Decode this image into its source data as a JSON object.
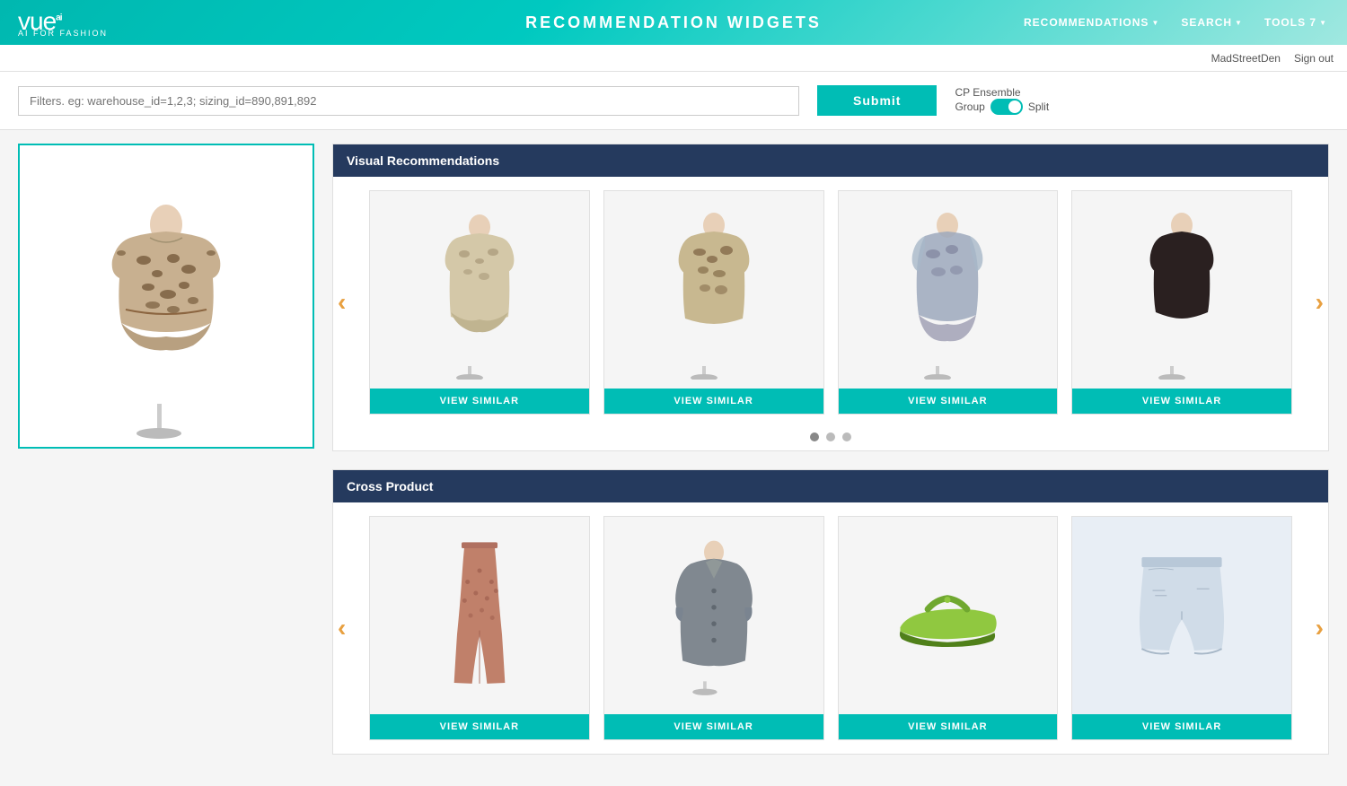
{
  "header": {
    "logo": "vue",
    "logo_sup": "ai",
    "logo_sub": "AI FOR FASHION",
    "title": "RECOMMENDATION  WIDGETS",
    "nav": [
      {
        "label": "RECOMMENDATIONS",
        "has_arrow": true
      },
      {
        "label": "SEARCH",
        "has_arrow": true
      },
      {
        "label": "TOOLS 7",
        "has_arrow": true
      }
    ]
  },
  "user_bar": {
    "username": "MadStreetDen",
    "signout": "Sign out"
  },
  "filter": {
    "placeholder": "Filters. eg: warehouse_id=1,2,3; sizing_id=890,891,892",
    "submit_label": "Submit",
    "toggle_label1": "CP Ensemble",
    "toggle_label2": "Group",
    "toggle_label3": "Split"
  },
  "visual_recommendations": {
    "section_title": "Visual Recommendations",
    "products": [
      {
        "id": 1,
        "view_similar": "VIEW SIMILAR",
        "color": "#e8d5b0",
        "type": "animal_top"
      },
      {
        "id": 2,
        "view_similar": "VIEW SIMILAR",
        "color": "#d4b896",
        "type": "animal_top2"
      },
      {
        "id": 3,
        "view_similar": "VIEW SIMILAR",
        "color": "#b0b8c8",
        "type": "sheer_top"
      },
      {
        "id": 4,
        "view_similar": "VIEW SIMILAR",
        "color": "#3a2a2a",
        "type": "dark_top"
      }
    ],
    "dots": [
      {
        "active": true
      },
      {
        "active": false
      },
      {
        "active": false
      }
    ],
    "arrow_left": "‹",
    "arrow_right": "›"
  },
  "cross_product": {
    "section_title": "Cross Product",
    "products": [
      {
        "id": 1,
        "view_similar": "VIEW SIMILAR",
        "color": "#c8a090",
        "type": "pants"
      },
      {
        "id": 2,
        "view_similar": "VIEW SIMILAR",
        "color": "#888888",
        "type": "jacket"
      },
      {
        "id": 3,
        "view_similar": "VIEW SIMILAR",
        "color": "#c8e090",
        "type": "shoes"
      },
      {
        "id": 4,
        "view_similar": "VIEW SIMILAR",
        "color": "#e0e8f0",
        "type": "shorts"
      }
    ],
    "arrow_left": "‹",
    "arrow_right": "›"
  }
}
